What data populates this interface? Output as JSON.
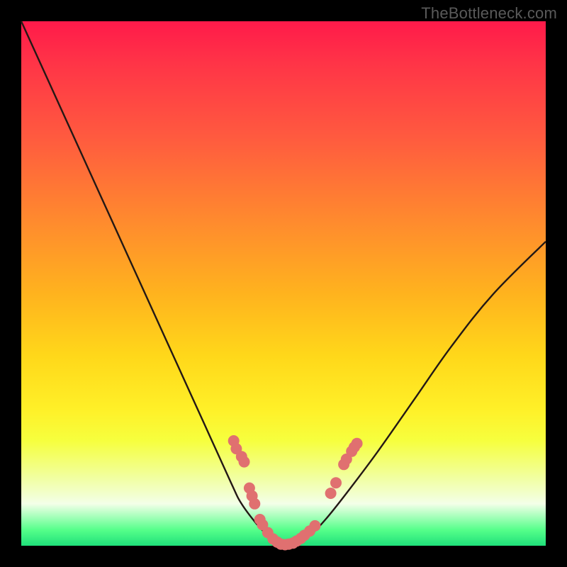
{
  "watermark": "TheBottleneck.com",
  "colors": {
    "page_bg": "#000000",
    "curve_stroke": "#231815",
    "marker_fill": "#e07070",
    "marker_stroke": "#c85a5a",
    "gradient_top": "#ff1a4a",
    "gradient_bottom": "#1fe07a",
    "watermark": "#5a5a5a"
  },
  "chart_data": {
    "type": "line",
    "title": "",
    "xlabel": "",
    "ylabel": "",
    "xlim": [
      0,
      100
    ],
    "ylim": [
      0,
      100
    ],
    "grid": false,
    "series": [
      {
        "name": "bottleneck-curve",
        "x": [
          0,
          5,
          10,
          15,
          20,
          25,
          30,
          35,
          40,
          42,
          45,
          47,
          49,
          50,
          52,
          55,
          58,
          62,
          68,
          75,
          82,
          90,
          100
        ],
        "y": [
          100,
          89,
          78,
          67,
          56,
          45,
          34,
          23,
          12,
          8,
          4,
          2,
          0.5,
          0,
          0.5,
          2,
          5,
          10,
          18,
          28,
          38,
          48,
          58
        ]
      }
    ],
    "markers": [
      {
        "x": 40.5,
        "y": 20
      },
      {
        "x": 41.0,
        "y": 18.5
      },
      {
        "x": 42.0,
        "y": 17
      },
      {
        "x": 42.5,
        "y": 16
      },
      {
        "x": 43.5,
        "y": 11
      },
      {
        "x": 44.0,
        "y": 9.5
      },
      {
        "x": 44.5,
        "y": 8
      },
      {
        "x": 45.5,
        "y": 5
      },
      {
        "x": 46.0,
        "y": 4
      },
      {
        "x": 47.0,
        "y": 2.5
      },
      {
        "x": 48.0,
        "y": 1.3
      },
      {
        "x": 48.8,
        "y": 0.7
      },
      {
        "x": 49.5,
        "y": 0.3
      },
      {
        "x": 50.3,
        "y": 0.2
      },
      {
        "x": 51.0,
        "y": 0.3
      },
      {
        "x": 51.8,
        "y": 0.5
      },
      {
        "x": 52.5,
        "y": 0.9
      },
      {
        "x": 53.3,
        "y": 1.4
      },
      {
        "x": 54.0,
        "y": 2.0
      },
      {
        "x": 55.0,
        "y": 2.8
      },
      {
        "x": 56.0,
        "y": 3.8
      },
      {
        "x": 59.0,
        "y": 10
      },
      {
        "x": 60.0,
        "y": 12
      },
      {
        "x": 61.5,
        "y": 15.5
      },
      {
        "x": 62.0,
        "y": 16.5
      },
      {
        "x": 63.0,
        "y": 18
      },
      {
        "x": 63.5,
        "y": 18.8
      },
      {
        "x": 64.0,
        "y": 19.5
      }
    ],
    "marker_radius_px": 8
  }
}
